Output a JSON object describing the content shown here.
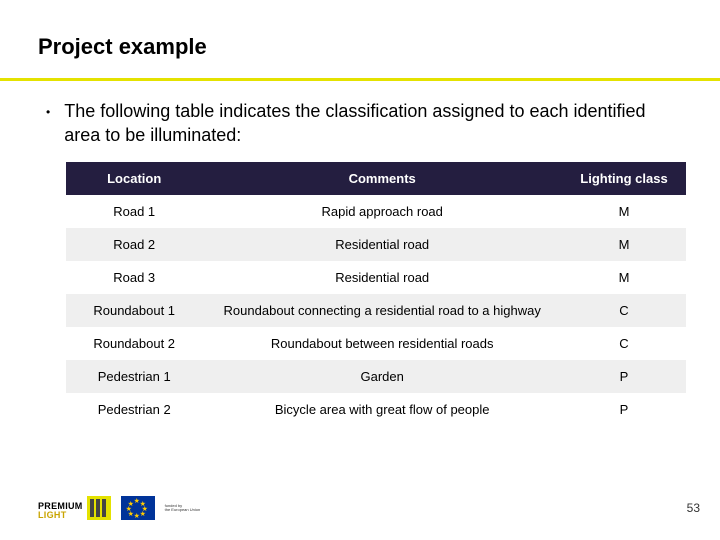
{
  "title": "Project example",
  "bullet": "The following table indicates the classification assigned to each identified area to be illuminated:",
  "table": {
    "headers": {
      "location": "Location",
      "comments": "Comments",
      "class": "Lighting class"
    },
    "rows": [
      {
        "location": "Road 1",
        "comments": "Rapid approach road",
        "class": "M"
      },
      {
        "location": "Road 2",
        "comments": "Residential road",
        "class": "M"
      },
      {
        "location": "Road 3",
        "comments": "Residential road",
        "class": "M"
      },
      {
        "location": "Roundabout 1",
        "comments": "Roundabout connecting a residential road to a highway",
        "class": "C"
      },
      {
        "location": "Roundabout 2",
        "comments": "Roundabout between residential roads",
        "class": "C"
      },
      {
        "location": "Pedestrian 1",
        "comments": "Garden",
        "class": "P"
      },
      {
        "location": "Pedestrian 2",
        "comments": "Bicycle area with great flow of people",
        "class": "P"
      }
    ]
  },
  "footer": {
    "logo_line1": "PREMIUM",
    "logo_line2": "LIGHT",
    "funded_line1": "funded by",
    "funded_line2": "the European Union",
    "page": "53"
  }
}
